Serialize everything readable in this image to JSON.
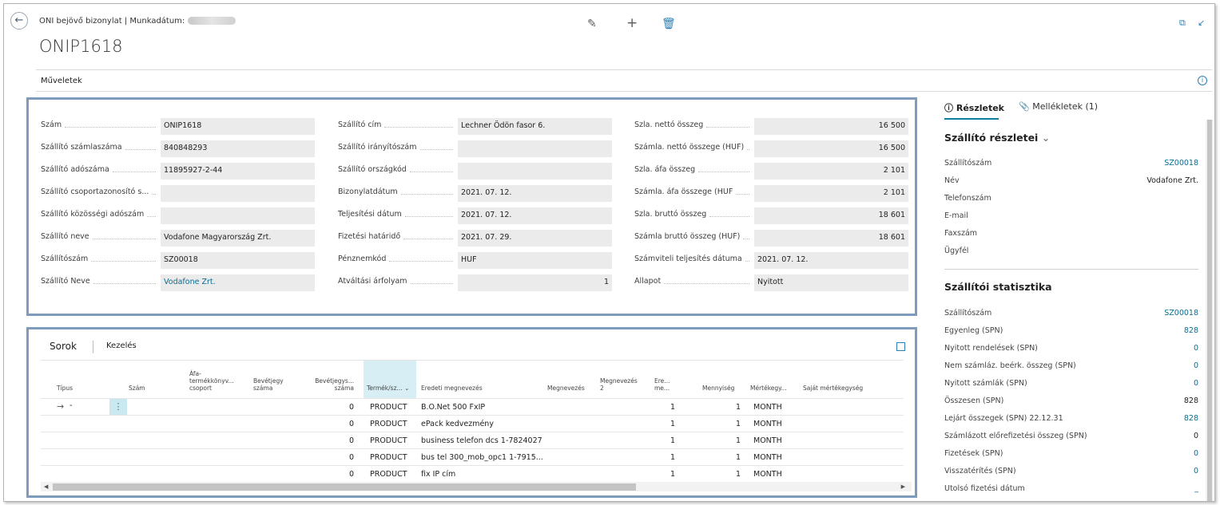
{
  "header": {
    "breadcrumb": "ONI bejövő bizonylat | Munkadátum:",
    "title": "ONIP1618",
    "actions_label": "Műveletek",
    "icons": [
      "back-arrow-icon",
      "edit-pencil-icon",
      "add-plus-icon",
      "delete-trash-icon",
      "open-new-window-icon",
      "collapse-icon",
      "info-icon"
    ]
  },
  "general": {
    "col1": [
      {
        "label": "Szám",
        "value": "ONIP1618"
      },
      {
        "label": "Szállító számlaszáma",
        "value": "840848293"
      },
      {
        "label": "Szállító adószáma",
        "value": "11895927-2-44"
      },
      {
        "label": "Szállító csoportazonosító s...",
        "value": ""
      },
      {
        "label": "Szállító közösségi adószám",
        "value": ""
      },
      {
        "label": "Szállító neve",
        "value": "Vodafone Magyarország Zrt."
      },
      {
        "label": "Szállítószám",
        "value": "SZ00018"
      },
      {
        "label": "Szállító Neve",
        "value": "Vodafone Zrt."
      }
    ],
    "col2": [
      {
        "label": "Szállító cím",
        "value": "Lechner Ödön fasor 6."
      },
      {
        "label": "Szállító irányítószám",
        "value": ""
      },
      {
        "label": "Szállító országkód",
        "value": ""
      },
      {
        "label": "Bizonylatdátum",
        "value": "2021. 07. 12."
      },
      {
        "label": "Teljesítési dátum",
        "value": "2021. 07. 12."
      },
      {
        "label": "Fizetési határidő",
        "value": "2021. 07. 29."
      },
      {
        "label": "Pénznemkód",
        "value": "HUF"
      },
      {
        "label": "Átváltási árfolyam",
        "value": "1"
      }
    ],
    "col3": [
      {
        "label": "Szla. nettó összeg",
        "value": "16 500"
      },
      {
        "label": "Számla. nettó összege (HUF)",
        "value": "16 500"
      },
      {
        "label": "Szla. áfa összeg",
        "value": "2 101"
      },
      {
        "label": "Számla. áfa összege (HUF",
        "value": "2 101"
      },
      {
        "label": "Szla. bruttó összeg",
        "value": "18 601"
      },
      {
        "label": "Számla bruttó összeg (HUF)",
        "value": "18 601"
      },
      {
        "label": "Számviteli teljesítés dátuma",
        "value": "2021. 07. 12."
      },
      {
        "label": "Állapot",
        "value": "Nyitott"
      }
    ]
  },
  "lines": {
    "tab_lines": "Sorok",
    "tab_manage": "Kezelés",
    "columns": {
      "tipus": "Típus",
      "szam": "Szám",
      "afa": "Áfa- termékkönyv... csoport",
      "bevetjegy": "Bevétjegy száma",
      "bevetjegys": "Bevétjegys... száma",
      "termek": "Termék/sz...",
      "eredeti": "Eredeti megnevezés",
      "megnevezes": "Megnevezés",
      "megnevezes2": "Megnevezés 2",
      "erem": "Ere... me...",
      "mennyiseg": "Mennyiség",
      "mertekegy": "Mértékegy...",
      "sajat": "Saját mértékegység"
    },
    "first_row_type": "-",
    "rows": [
      {
        "bevetjegys": "0",
        "termek": "PRODUCT",
        "eredeti": "B.O.Net 500 FxIP",
        "erem": "1",
        "mennyiseg": "1",
        "mertekegy": "MONTH"
      },
      {
        "bevetjegys": "0",
        "termek": "PRODUCT",
        "eredeti": "ePack kedvezmény",
        "erem": "1",
        "mennyiseg": "1",
        "mertekegy": "MONTH"
      },
      {
        "bevetjegys": "0",
        "termek": "PRODUCT",
        "eredeti": "business telefon dcs 1-7824027",
        "erem": "1",
        "mennyiseg": "1",
        "mertekegy": "MONTH"
      },
      {
        "bevetjegys": "0",
        "termek": "PRODUCT",
        "eredeti": "bus tel 300_mob_opc1 1-7915...",
        "erem": "1",
        "mennyiseg": "1",
        "mertekegy": "MONTH"
      },
      {
        "bevetjegys": "0",
        "termek": "PRODUCT",
        "eredeti": "fix IP cím",
        "erem": "1",
        "mennyiseg": "1",
        "mertekegy": "MONTH"
      }
    ]
  },
  "factbox": {
    "tab_details": "Részletek",
    "tab_attachments": "Mellékletek (1)",
    "vendor_details_title": "Szállító részletei",
    "vendor_details": [
      {
        "k": "Szállítószám",
        "v": "SZ00018",
        "link": true
      },
      {
        "k": "Név",
        "v": "Vodafone Zrt.",
        "link": false
      },
      {
        "k": "Telefonszám",
        "v": "",
        "link": false
      },
      {
        "k": "E-mail",
        "v": "",
        "link": false
      },
      {
        "k": "Faxszám",
        "v": "",
        "link": false
      },
      {
        "k": "Ügyfél",
        "v": "",
        "link": false
      }
    ],
    "vendor_stats_title": "Szállítói statisztika",
    "vendor_stats": [
      {
        "k": "Szállítószám",
        "v": "SZ00018",
        "link": true
      },
      {
        "k": "Egyenleg (SPN)",
        "v": "828",
        "link": true
      },
      {
        "k": "Nyitott rendelések (SPN)",
        "v": "0",
        "link": true
      },
      {
        "k": "Nem számláz. beérk. összeg (SPN)",
        "v": "0",
        "link": true
      },
      {
        "k": "Nyitott számlák (SPN)",
        "v": "0",
        "link": true
      },
      {
        "k": "Összesen (SPN)",
        "v": "828",
        "link": false
      },
      {
        "k": "Lejárt összegek (SPN) 22.12.31",
        "v": "828",
        "link": true
      },
      {
        "k": "Számlázott előrefizetési összeg (SPN)",
        "v": "0",
        "link": false
      },
      {
        "k": "Fizetések (SPN)",
        "v": "0",
        "link": true
      },
      {
        "k": "Visszatérítés (SPN)",
        "v": "0",
        "link": true
      },
      {
        "k": "Utolsó fizetési dátum",
        "v": "_",
        "link": true
      }
    ]
  },
  "colors": {
    "accent": "#0a6c8f",
    "highlight_frame": "#7d9cbd",
    "field_bg": "#ebebeb"
  }
}
